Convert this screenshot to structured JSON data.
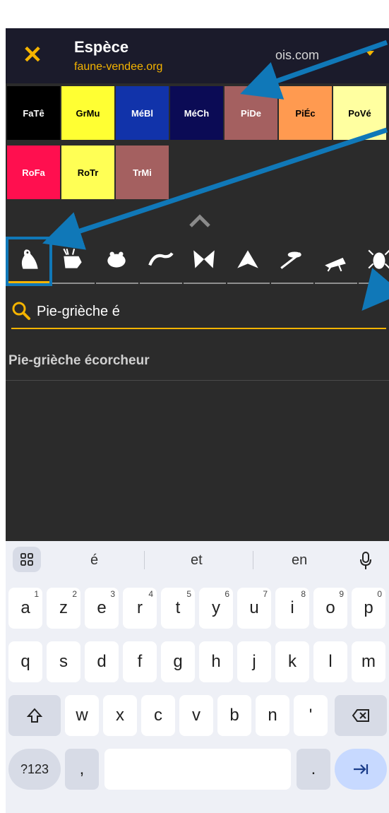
{
  "appbar": {
    "title": "Espèce",
    "subtitle": "faune-vendee.org",
    "domain": "ois.com"
  },
  "chips": [
    {
      "label": "FaTê",
      "bg": "#000000",
      "fg": "#ffffff"
    },
    {
      "label": "GrMu",
      "bg": "#ffff33",
      "fg": "#000000"
    },
    {
      "label": "MéBl",
      "bg": "#1133aa",
      "fg": "#ffffff"
    },
    {
      "label": "MéCh",
      "bg": "#0b0b55",
      "fg": "#ffffff"
    },
    {
      "label": "PiDe",
      "bg": "#a46060",
      "fg": "#ffffff"
    },
    {
      "label": "PiÉc",
      "bg": "#ff9a50",
      "fg": "#000000"
    },
    {
      "label": "PoVé",
      "bg": "#ffffa0",
      "fg": "#000000"
    },
    {
      "label": "RoFa",
      "bg": "#ff0f4f",
      "fg": "#ffffff"
    },
    {
      "label": "RoTr",
      "bg": "#ffff55",
      "fg": "#000000"
    },
    {
      "label": "TrMi",
      "bg": "#a46060",
      "fg": "#ffffff"
    }
  ],
  "taxon_tabs": [
    {
      "icon": "bird-icon",
      "active": true
    },
    {
      "icon": "deer-icon",
      "active": false
    },
    {
      "icon": "frog-icon",
      "active": false
    },
    {
      "icon": "lizard-icon",
      "active": false
    },
    {
      "icon": "butterfly-icon",
      "active": false
    },
    {
      "icon": "moth-icon",
      "active": false
    },
    {
      "icon": "dragonfly-icon",
      "active": false
    },
    {
      "icon": "grasshopper-icon",
      "active": false
    },
    {
      "icon": "beetle-icon",
      "active": false
    }
  ],
  "search": {
    "value": "Pie-grièche é"
  },
  "results": [
    "Pie-grièche écorcheur"
  ],
  "keyboard": {
    "suggestions": [
      "é",
      "et",
      "en"
    ],
    "row1": [
      {
        "k": "a",
        "h": "1"
      },
      {
        "k": "z",
        "h": "2"
      },
      {
        "k": "e",
        "h": "3"
      },
      {
        "k": "r",
        "h": "4"
      },
      {
        "k": "t",
        "h": "5"
      },
      {
        "k": "y",
        "h": "6"
      },
      {
        "k": "u",
        "h": "7"
      },
      {
        "k": "i",
        "h": "8"
      },
      {
        "k": "o",
        "h": "9"
      },
      {
        "k": "p",
        "h": "0"
      }
    ],
    "row2": [
      "q",
      "s",
      "d",
      "f",
      "g",
      "h",
      "j",
      "k",
      "l",
      "m"
    ],
    "row3": [
      "w",
      "x",
      "c",
      "v",
      "b",
      "n",
      "'"
    ],
    "symbols_label": "?123",
    "comma": ",",
    "period": "."
  },
  "colors": {
    "accent": "#f5b400",
    "annotation": "#1078b8"
  }
}
